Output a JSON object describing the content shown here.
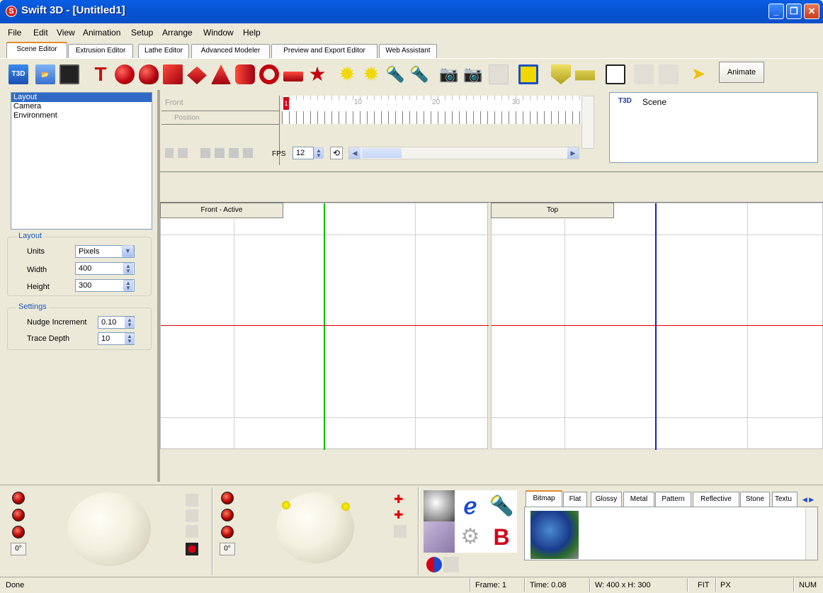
{
  "window": {
    "title": "Swift 3D - [Untitled1]",
    "app_icon": "S"
  },
  "menu": [
    "File",
    "Edit",
    "View",
    "Animation",
    "Setup",
    "Arrange",
    "Window",
    "Help"
  ],
  "tabs": [
    "Scene Editor",
    "Extrusion Editor",
    "Lathe Editor",
    "Advanced Modeler",
    "Preview and Export Editor",
    "Web Assistant"
  ],
  "toolbar": {
    "animate_label": "Animate",
    "t3d_label": "T3D"
  },
  "left_list": [
    "Layout",
    "Camera",
    "Environment"
  ],
  "layout_group": {
    "title": "Layout",
    "units_label": "Units",
    "units_value": "Pixels",
    "width_label": "Width",
    "width_value": "400",
    "height_label": "Height",
    "height_value": "300"
  },
  "settings_group": {
    "title": "Settings",
    "nudge_label": "Nudge Increment",
    "nudge_value": "0.10",
    "trace_label": "Trace Depth",
    "trace_value": "10"
  },
  "timeline": {
    "track_name": "Front",
    "sub_track": "Position",
    "ticks": [
      "10",
      "20",
      "30"
    ],
    "current_frame_marker": "1",
    "fps_label": "FPS",
    "fps_value": "12"
  },
  "scene_tree": {
    "root_icon_label": "T3D",
    "root_label": "Scene"
  },
  "viewports": [
    {
      "label": "Front - Active"
    },
    {
      "label": "Top"
    }
  ],
  "lighting": {
    "degree_left": "0°",
    "degree_right": "0°"
  },
  "material_tabs": [
    "Bitmap",
    "Flat",
    "Glossy",
    "Metal",
    "Pattern",
    "Reflective",
    "Stone",
    "Textu"
  ],
  "status": {
    "left": "Done",
    "frame": "Frame: 1",
    "time": "Time: 0.08",
    "size": "W: 400 x H: 300",
    "fit": "FIT",
    "units": "PX",
    "num": "NUM"
  },
  "colors": {
    "accent_red": "#d4001a",
    "vp_green_axis": "#00c000",
    "vp_red_axis": "#e00000",
    "vp_blue_axis": "#1a1ad0",
    "title_blue": "#0a5ee4"
  }
}
